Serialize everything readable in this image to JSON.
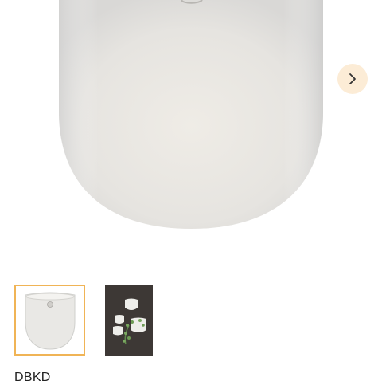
{
  "gallery": {
    "main_image_alt": "",
    "next_button_icon": "chevron-right-icon",
    "accent_color": "#f0b456",
    "next_button_bg": "#fcecd6",
    "thumbnails": [
      {
        "selected": true
      },
      {
        "selected": false
      }
    ]
  },
  "product": {
    "brand": "DBKD"
  }
}
